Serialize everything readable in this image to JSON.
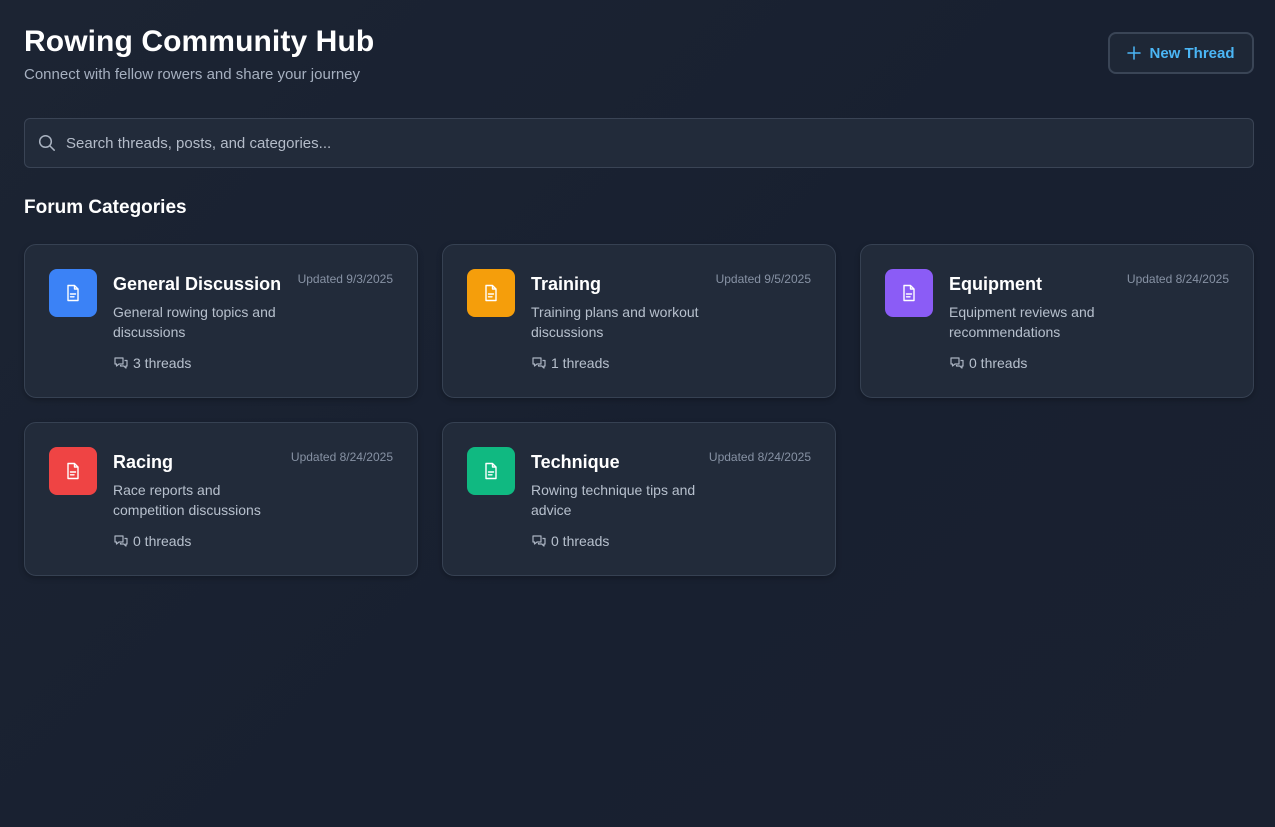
{
  "header": {
    "title": "Rowing Community Hub",
    "subtitle": "Connect with fellow rowers and share your journey",
    "new_thread_label": "New Thread",
    "new_thread_icon": "plus-icon"
  },
  "search": {
    "placeholder": "Search threads, posts, and categories...",
    "value": "",
    "icon": "search-icon"
  },
  "section_title": "Forum Categories",
  "colors": {
    "accent": "#4bb6f5",
    "general": "#3b82f6",
    "training": "#f59e0b",
    "equipment": "#8b5cf6",
    "racing": "#ef4444",
    "technique": "#10b981"
  },
  "categories": [
    {
      "title": "General Discussion",
      "description": "General rowing topics and discussions",
      "updated": "Updated 9/3/2025",
      "threads": "3 threads",
      "color": "#3b82f6",
      "icon": "document-icon"
    },
    {
      "title": "Training",
      "description": "Training plans and workout discussions",
      "updated": "Updated 9/5/2025",
      "threads": "1 threads",
      "color": "#f59e0b",
      "icon": "document-icon"
    },
    {
      "title": "Equipment",
      "description": "Equipment reviews and recommendations",
      "updated": "Updated 8/24/2025",
      "threads": "0 threads",
      "color": "#8b5cf6",
      "icon": "document-icon"
    },
    {
      "title": "Racing",
      "description": "Race reports and competition discussions",
      "updated": "Updated 8/24/2025",
      "threads": "0 threads",
      "color": "#ef4444",
      "icon": "document-icon"
    },
    {
      "title": "Technique",
      "description": "Rowing technique tips and advice",
      "updated": "Updated 8/24/2025",
      "threads": "0 threads",
      "color": "#10b981",
      "icon": "document-icon"
    }
  ]
}
